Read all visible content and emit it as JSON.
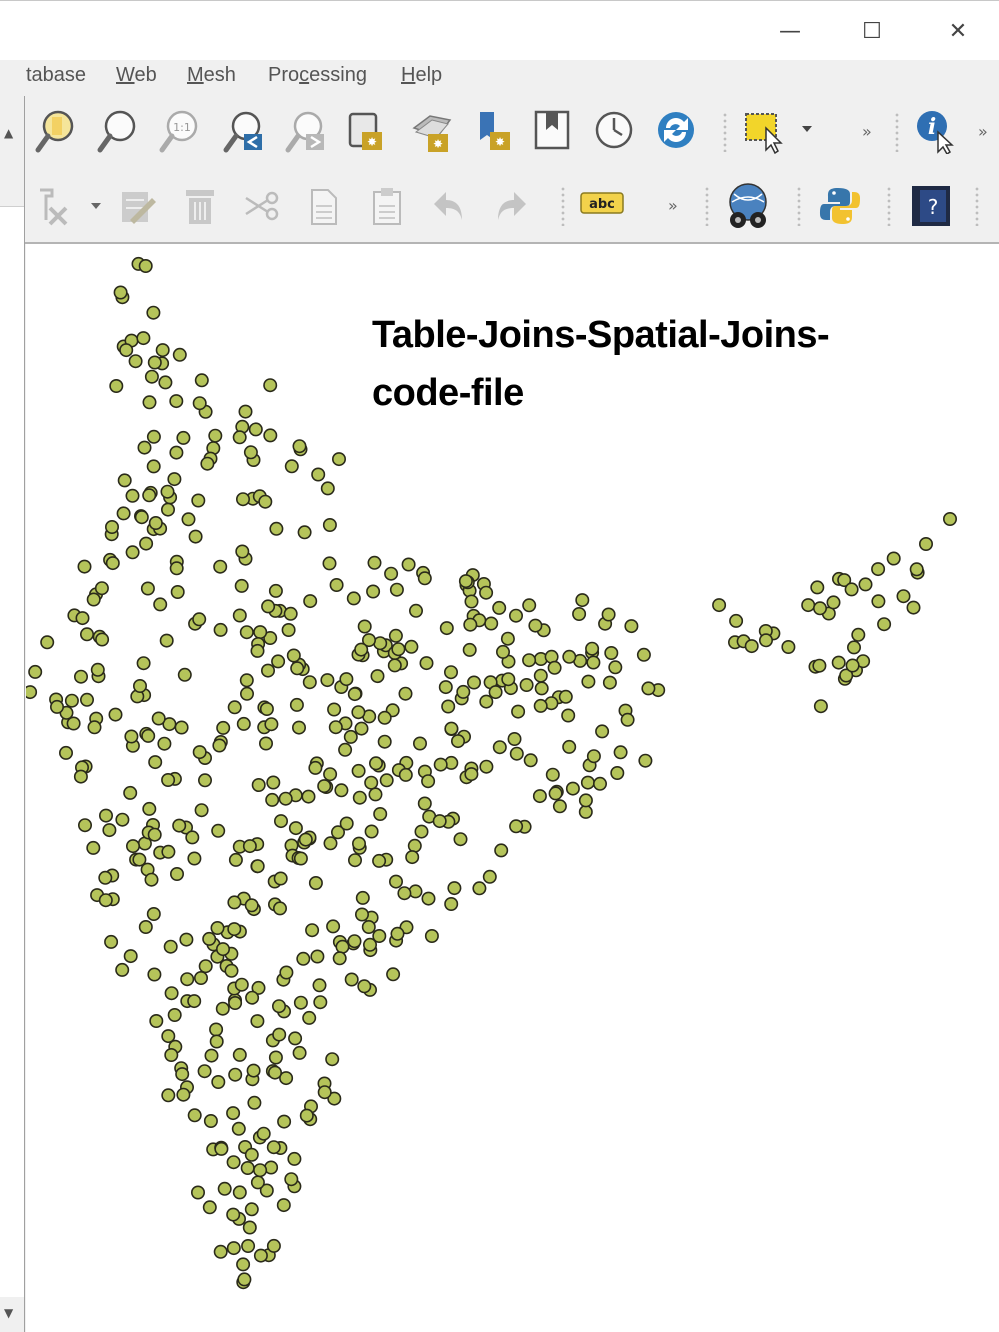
{
  "window": {
    "minimize_glyph": "—",
    "maximize_glyph": "☐",
    "close_glyph": "✕"
  },
  "menu": {
    "items": [
      {
        "label": "tabase"
      },
      {
        "label": "Web",
        "mnemonic": "W"
      },
      {
        "label": "Mesh",
        "mnemonic": "M"
      },
      {
        "label": "Processing",
        "mnemonic": "c"
      },
      {
        "label": "Help",
        "mnemonic": "H"
      }
    ]
  },
  "toolbar1": {
    "icons": [
      "zoom-in-icon",
      "zoom-out-icon",
      "zoom-native-icon",
      "zoom-last-icon",
      "zoom-next-icon",
      "new-spatial-bookmark-icon",
      "show-bookmarks-icon",
      "map-tips-icon",
      "bookmark-icon",
      "temporal-controller-icon",
      "refresh-icon",
      "select-features-icon",
      "identify-features-icon"
    ],
    "overflow": "»"
  },
  "toolbar2": {
    "icons": [
      "digitize-icon",
      "edit-pencil-icon",
      "delete-selected-icon",
      "cut-features-icon",
      "copy-features-icon",
      "paste-features-icon",
      "undo-icon",
      "redo-icon",
      "label-abc-icon",
      "georeference-globe-icon",
      "python-console-icon",
      "help-icon"
    ],
    "label_button": "abc",
    "help_glyph": "?",
    "overflow": "»"
  },
  "annotation": {
    "line1": "Table-Joins-Spatial-Joins-",
    "line2": "code-file"
  },
  "colors": {
    "point_fill": "#b5c45a",
    "point_stroke": "#2a2a1a",
    "toolbar_bg": "#f0f0f0",
    "canvas_bg": "#ffffff"
  },
  "map": {
    "layer_type": "point",
    "point_count": 600
  }
}
